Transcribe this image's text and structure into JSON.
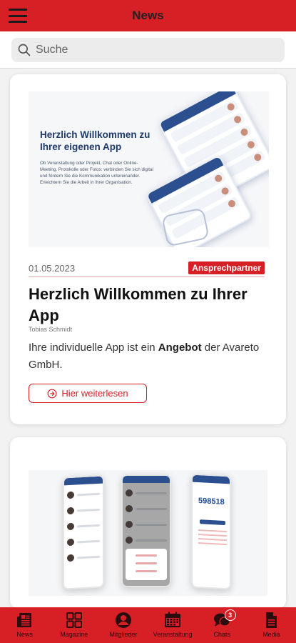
{
  "header": {
    "title": "News"
  },
  "search": {
    "placeholder": "Suche"
  },
  "articles": [
    {
      "hero_title": "Herzlich Willkommen zu Ihrer eigenen App",
      "hero_text": "Ob Veranstaltung oder Projekt, Chat oder Online-Meeting, Protokolle oder Fotos: verbinden Sie sich digital und fördern Sie die Kommunikation untereinander. Erleichtern Sie die Arbeit in Ihrer Organisation.",
      "date": "01.05.2023",
      "category": "Ansprechpartner",
      "title": "Herzlich Willkommen zu Ihrer App",
      "author": "Tobias Schmidt",
      "excerpt_pre": "Ihre individuelle App ist ein ",
      "excerpt_bold": "Angebot",
      "excerpt_post": " der Avareto GmbH.",
      "read_more": "Hier weiterlesen"
    },
    {
      "mock_code": "598518"
    }
  ],
  "tabs": [
    {
      "label": "News",
      "icon": "newspaper-icon"
    },
    {
      "label": "Magazine",
      "icon": "grid-icon"
    },
    {
      "label": "Mitglieder",
      "icon": "user-icon"
    },
    {
      "label": "Veranstaltung",
      "icon": "calendar-icon"
    },
    {
      "label": "Chats",
      "icon": "chat-icon",
      "badge": "3"
    },
    {
      "label": "Media",
      "icon": "file-icon"
    }
  ],
  "colors": {
    "accent": "#d71f26",
    "link": "#d71f26",
    "navy": "#1d3a6a"
  }
}
